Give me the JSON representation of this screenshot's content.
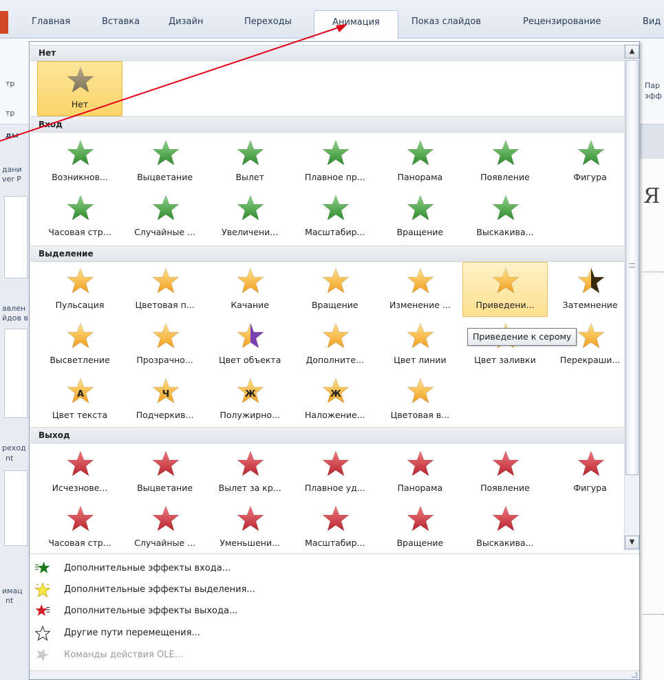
{
  "tabs": [
    "Главная",
    "Вставка",
    "Дизайн",
    "Переходы",
    "Анимация",
    "Показ слайдов",
    "Рецензирование",
    "Вид"
  ],
  "active_tab": "Анимация",
  "background_fragments": {
    "left": [
      "тр",
      "тр",
      "ды",
      "дани",
      "ver P",
      "авлен",
      "йдов в",
      "реход",
      "nt",
      "имац",
      "nt"
    ],
    "right": [
      "Пар",
      "эфф",
      "Я"
    ]
  },
  "sections": {
    "none": "Нет",
    "entrance": "Вход",
    "emphasis": "Выделение",
    "exit": "Выход"
  },
  "none_items": [
    "Нет"
  ],
  "entrance_items": [
    "Возникнов...",
    "Выцветание",
    "Вылет",
    "Плавное пр...",
    "Панорама",
    "Появление",
    "Фигура",
    "Часовая стр...",
    "Случайные ...",
    "Увеличени...",
    "Масштабир...",
    "Вращение",
    "Выскакива..."
  ],
  "emphasis_items": [
    "Пульсация",
    "Цветовая п...",
    "Качание",
    "Вращение",
    "Изменение ...",
    "Приведени...",
    "Затемнение",
    "Высветление",
    "Прозрачно...",
    "Цвет объекта",
    "Дополните...",
    "Цвет линии",
    "Цвет заливки",
    "Перекраши...",
    "Цвет текста",
    "Подчеркив...",
    "Полужирно...",
    "Наложение...",
    "Цветовая в..."
  ],
  "emphasis_letters": {
    "text_color": "A",
    "underline": "Ч",
    "bold": "Ж",
    "overlay": "Ж"
  },
  "exit_items": [
    "Исчезнове...",
    "Выцветание",
    "Вылет за кр...",
    "Плавное уд...",
    "Панорама",
    "Появление",
    "Фигура",
    "Часовая стр...",
    "Случайные ...",
    "Уменьшени...",
    "Масштабир...",
    "Вращение",
    "Выскакива..."
  ],
  "tooltip": "Приведение к серому",
  "commands": [
    {
      "label": "Дополнительные эффекты входа...",
      "icon": "entrance-effects-icon",
      "enabled": true
    },
    {
      "label": "Дополнительные эффекты выделения...",
      "icon": "emphasis-effects-icon",
      "enabled": true
    },
    {
      "label": "Дополнительные эффекты выхода...",
      "icon": "exit-effects-icon",
      "enabled": true
    },
    {
      "label": "Другие пути перемещения...",
      "icon": "motion-path-icon",
      "enabled": true
    },
    {
      "label": "Команды действия OLE...",
      "icon": "ole-action-icon",
      "enabled": false
    }
  ],
  "colors": {
    "entrance": "#3f9a3a",
    "emphasis": "#f2a52c",
    "exit": "#c8323c",
    "selection": "#fbd56a",
    "arrow": "#e3001b"
  }
}
